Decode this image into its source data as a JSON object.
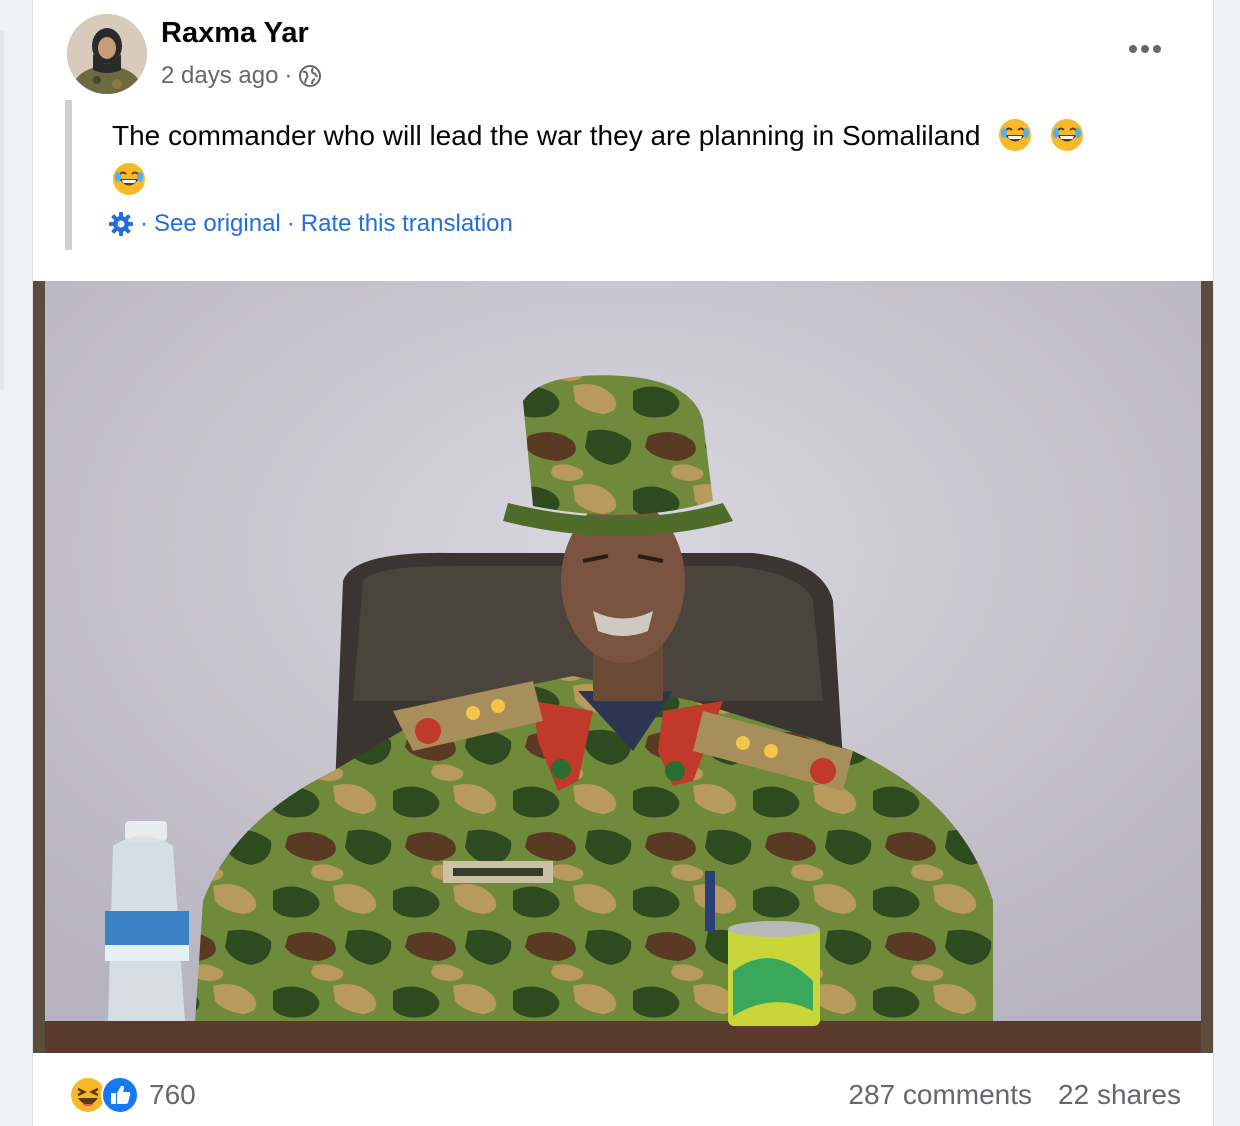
{
  "post": {
    "author": "Raxma Yar",
    "timestamp": "2 days ago",
    "separator": "·",
    "audience_icon": "globe-icon",
    "menu_icon": "more-horizontal-icon",
    "text": "The commander who will lead the war they are planning in Somaliland",
    "text_emojis": [
      "face-with-tears-of-joy",
      "face-with-tears-of-joy",
      "face-with-tears-of-joy"
    ],
    "translation": {
      "icon": "gear-icon",
      "see_original": "See original",
      "rate": "Rate this translation"
    },
    "photo_alt": "",
    "footer": {
      "reaction_icons": [
        "laugh-reaction-icon",
        "like-reaction-icon"
      ],
      "reaction_count": "760",
      "comments": "287 comments",
      "shares": "22 shares"
    }
  },
  "colors": {
    "link": "#216fdb",
    "secondary_text": "#65676b",
    "like_blue": "#1877f2",
    "emoji_yellow": "#f7b928"
  }
}
